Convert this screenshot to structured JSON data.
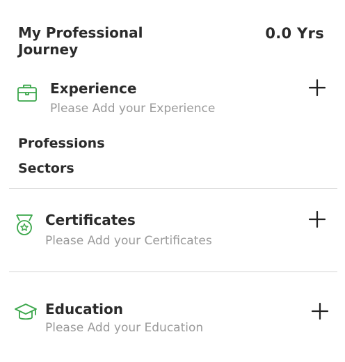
{
  "header": {
    "title": "My Professional Journey",
    "total_experience": "0.0 Yrs"
  },
  "experience": {
    "icon": "briefcase-icon",
    "title": "Experience",
    "subtitle": "Please Add your Experience",
    "add_icon": "plus-icon"
  },
  "professions_label": "Professions",
  "sectors_label": "Sectors",
  "certificates": {
    "icon": "medal-icon",
    "title": "Certificates",
    "subtitle": "Please Add your Certificates",
    "add_icon": "plus-icon"
  },
  "education": {
    "icon": "graduation-cap-icon",
    "title": "Education",
    "subtitle": "Please Add your Education",
    "add_icon": "plus-icon"
  },
  "colors": {
    "accent_green": "#3aa64a",
    "text_dark": "#2b2b2b",
    "text_muted": "#9a9a9a",
    "divider": "#d4d4d4"
  }
}
